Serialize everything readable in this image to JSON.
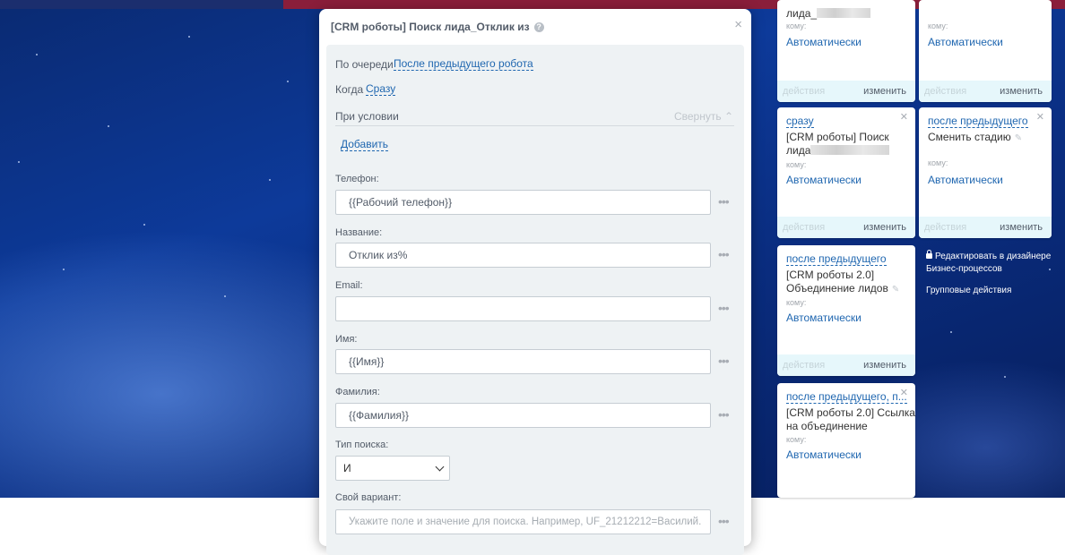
{
  "modal": {
    "title": "[CRM роботы] Поиск лида_Отклик из",
    "help_icon": "?",
    "close_icon": "×",
    "order_label": "По очереди",
    "order_value": "После предыдущего робота",
    "when_label": "Когда",
    "when_value": "Сразу",
    "condition_label": "При условии",
    "collapse_label": "Свернуть",
    "add_label": "Добавить",
    "fields": {
      "phone": {
        "label": "Телефон:",
        "value": "{{Рабочий телефон}}"
      },
      "title": {
        "label": "Название:",
        "value": "Отклик из%"
      },
      "email": {
        "label": "Email:",
        "value": ""
      },
      "name": {
        "label": "Имя:",
        "value": "{{Имя}}"
      },
      "lastname": {
        "label": "Фамилия:",
        "value": "{{Фамилия}}"
      },
      "search_type": {
        "label": "Тип поиска:",
        "value": "И"
      },
      "custom": {
        "label": "Свой вариант:",
        "placeholder": "Укажите поле и значение для поиска. Например, UF_21212212=Василий."
      }
    },
    "more_icon": "•••"
  },
  "cards": [
    {
      "trigger": "",
      "name_line1": "лида_",
      "komu": "кому:",
      "auto": "Автоматически",
      "actions": "действия",
      "change": "изменить"
    },
    {
      "trigger": "",
      "komu": "кому:",
      "auto": "Автоматически",
      "actions": "действия",
      "change": "изменить"
    },
    {
      "trigger": "сразу",
      "name_line1": "[CRM роботы] Поиск",
      "name_line2": "лида",
      "komu": "кому:",
      "auto": "Автоматически",
      "actions": "действия",
      "change": "изменить"
    },
    {
      "trigger": "после предыдущего",
      "name_line1": "Сменить стадию",
      "komu": "кому:",
      "auto": "Автоматически",
      "actions": "действия",
      "change": "изменить"
    },
    {
      "trigger": "после предыдущего",
      "name_line1": "[CRM роботы 2.0]",
      "name_line2": "Объединение лидов",
      "komu": "кому:",
      "auto": "Автоматически",
      "actions": "действия",
      "change": "изменить"
    },
    {
      "trigger": "после предыдущего, п...",
      "name_line1": "[CRM роботы 2.0] Ссылка",
      "name_line2": "на объединение",
      "komu": "кому:",
      "auto": "Автоматически"
    }
  ],
  "side": {
    "designer_line1": "Редактировать в дизайнере",
    "designer_line2": "Бизнес-процессов",
    "group_actions": "Групповые действия"
  },
  "colors": {
    "accent": "#2067b0",
    "panel": "#eef2f4",
    "card_footer": "#e6f7fb"
  }
}
